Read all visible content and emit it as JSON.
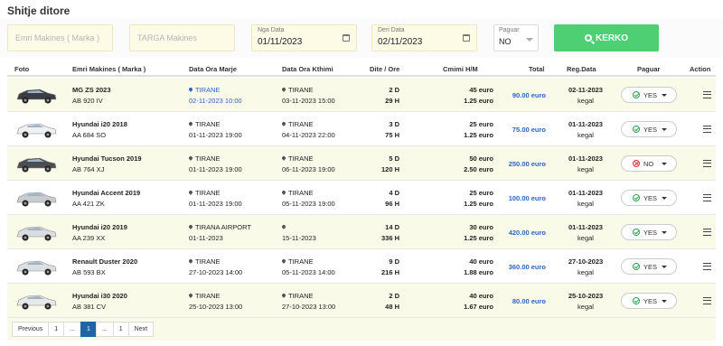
{
  "page": {
    "title": "Shitje ditore"
  },
  "filters": {
    "car_name_placeholder": "Emri Makines ( Marka )",
    "plate_placeholder": "TARGA Makines",
    "from_label": "Nga Data",
    "from_value": "01/11/2023",
    "to_label": "Deri Data",
    "to_value": "02/11/2023",
    "paid_label": "Paguar",
    "paid_value": "NO",
    "search_label": "KERKO"
  },
  "columns": {
    "photo": "Foto",
    "car": "Emri Makines ( Marka )",
    "pickup": "Data Ora Marje",
    "return": "Data Ora Kthimi",
    "days": "Dite / Ore",
    "price": "Cmimi H/M",
    "total": "Total",
    "reg": "Reg.Data",
    "paid": "Paguar",
    "action": "Action"
  },
  "rows": [
    {
      "car": "MG ZS 2023",
      "plate": "AB 920 IV",
      "pickup_city": "TIRANE",
      "pickup_dt": "02-11-2023 10:00",
      "return_city": "TIRANE",
      "return_dt": "03-11-2023 15:00",
      "days": "2 D",
      "hours": "29 H",
      "price_day": "45 euro",
      "price_hour": "1.25 euro",
      "total": "90.00 euro",
      "reg_date": "02-11-2023",
      "reg_user": "kegal",
      "paid": "YES",
      "car_color": "#3a3d44"
    },
    {
      "car": "Hyundai i20 2018",
      "plate": "AA 684 SO",
      "pickup_city": "TIRANE",
      "pickup_dt": "01-11-2023 19:00",
      "return_city": "TIRANE",
      "return_dt": "04-11-2023 22:00",
      "days": "3 D",
      "hours": "75 H",
      "price_day": "25 euro",
      "price_hour": "1.25 euro",
      "total": "75.00 euro",
      "reg_date": "01-11-2023",
      "reg_user": "kegal",
      "paid": "YES",
      "car_color": "#eef0f2"
    },
    {
      "car": "Hyundai Tucson 2019",
      "plate": "AB 764 XJ",
      "pickup_city": "TIRANE",
      "pickup_dt": "01-11-2023 19:00",
      "return_city": "TIRANE",
      "return_dt": "06-11-2023 19:00",
      "days": "5 D",
      "hours": "120 H",
      "price_day": "50 euro",
      "price_hour": "2.50 euro",
      "total": "250.00 euro",
      "reg_date": "01-11-2023",
      "reg_user": "kegal",
      "paid": "NO",
      "car_color": "#4a4d52"
    },
    {
      "car": "Hyundai Accent 2019",
      "plate": "AA 421 ZK",
      "pickup_city": "TIRANE",
      "pickup_dt": "01-11-2023 19:00",
      "return_city": "TIRANE",
      "return_dt": "05-11-2023 19:00",
      "days": "4 D",
      "hours": "96 H",
      "price_day": "25 euro",
      "price_hour": "1.25 euro",
      "total": "100.00 euro",
      "reg_date": "01-11-2023",
      "reg_user": "kegal",
      "paid": "YES",
      "car_color": "#c8cbcf"
    },
    {
      "car": "Hyundai i20 2019",
      "plate": "AA 239 XX",
      "pickup_city": "TIRANA AIRPORT",
      "pickup_dt": "01-11-2023",
      "return_city": "",
      "return_dt": "15-11-2023",
      "days": "14 D",
      "hours": "336 H",
      "price_day": "30 euro",
      "price_hour": "1.25 euro",
      "total": "420.00 euro",
      "reg_date": "01-11-2023",
      "reg_user": "kegal",
      "paid": "YES",
      "car_color": "#d9dce0"
    },
    {
      "car": "Renault Duster 2020",
      "plate": "AB 593 BX",
      "pickup_city": "TIRANE",
      "pickup_dt": "27-10-2023 14:00",
      "return_city": "TIRANE",
      "return_dt": "05-11-2023 14:00",
      "days": "9 D",
      "hours": "216 H",
      "price_day": "40 euro",
      "price_hour": "1.88 euro",
      "total": "360.00 euro",
      "reg_date": "27-10-2023",
      "reg_user": "kegal",
      "paid": "YES",
      "car_color": "#dcdfe2"
    },
    {
      "car": "Hyundai i30 2020",
      "plate": "AB 381 CV",
      "pickup_city": "TIRANE",
      "pickup_dt": "25-10-2023 13:00",
      "return_city": "TIRANE",
      "return_dt": "27-10-2023 13:00",
      "days": "2 D",
      "hours": "48 H",
      "price_day": "40 euro",
      "price_hour": "1.67 euro",
      "total": "80.00 euro",
      "reg_date": "25-10-2023",
      "reg_user": "kegal",
      "paid": "YES",
      "car_color": "#e6e8ea"
    }
  ],
  "pagination": [
    "Previous",
    "1",
    "...",
    "1",
    "...",
    "1",
    "Next"
  ],
  "pagination_active": 3
}
